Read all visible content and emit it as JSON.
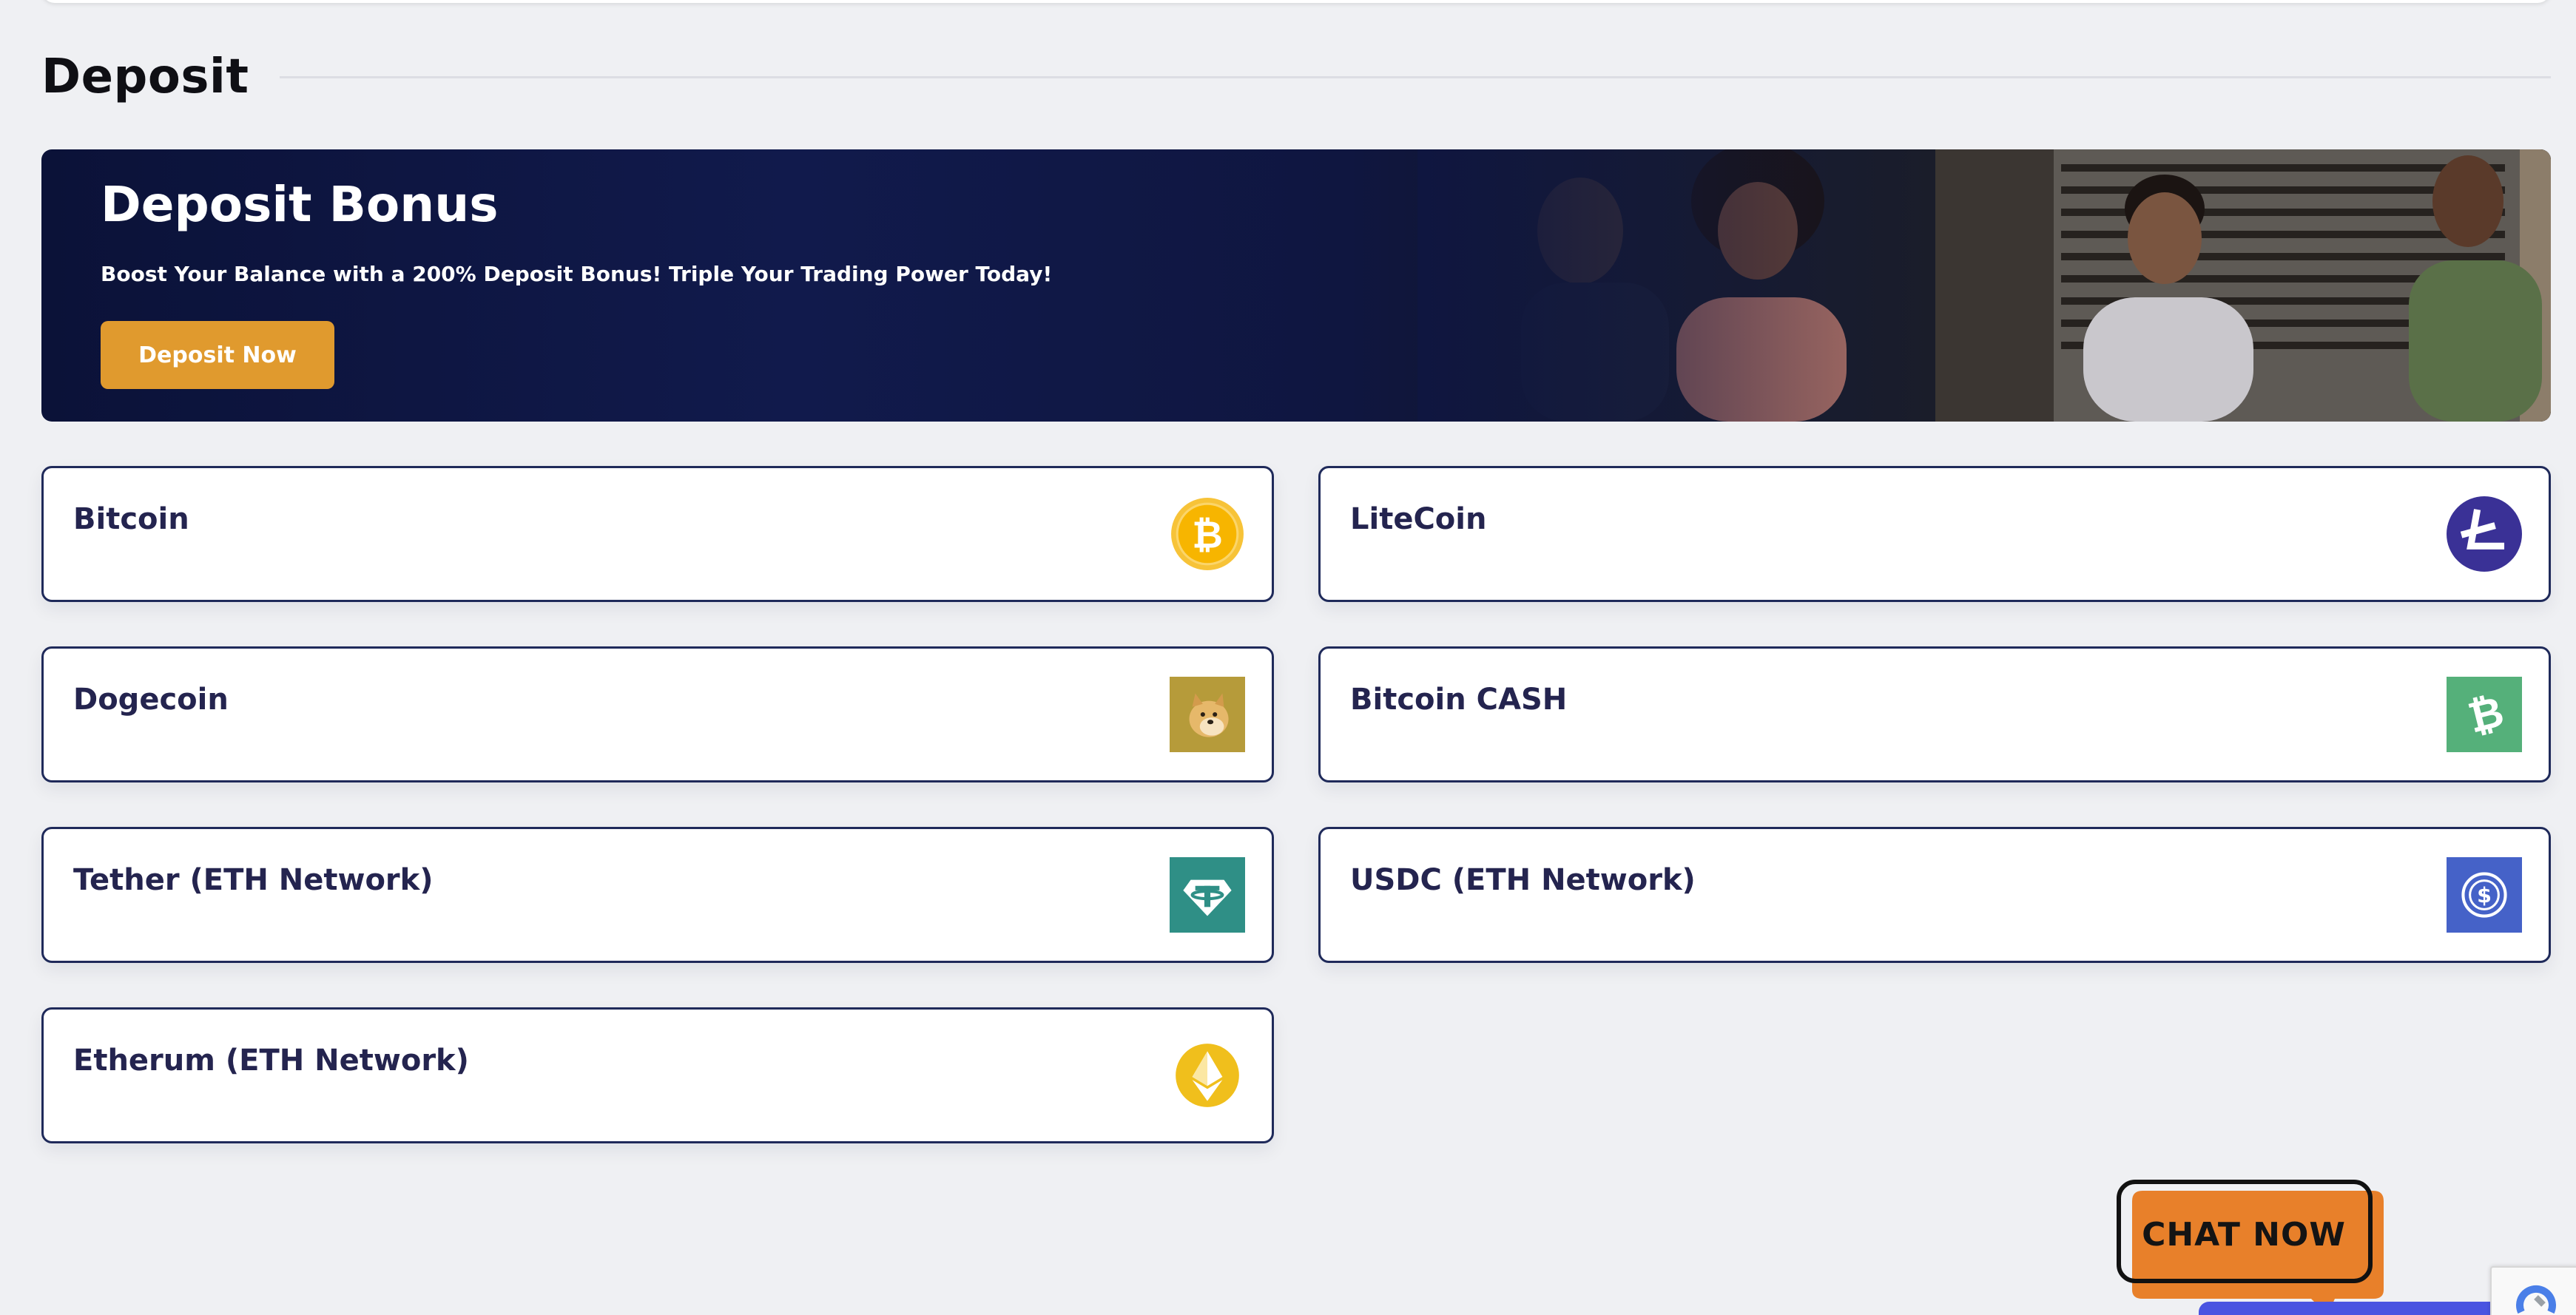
{
  "section": {
    "title": "Deposit"
  },
  "banner": {
    "title": "Deposit Bonus",
    "subtitle": "Boost Your Balance with a 200% Deposit Bonus! Triple Your Trading Power Today!",
    "button_label": "Deposit Now"
  },
  "methods": [
    {
      "label": "Bitcoin",
      "icon": "bitcoin-icon"
    },
    {
      "label": "LiteCoin",
      "icon": "litecoin-icon"
    },
    {
      "label": "Dogecoin",
      "icon": "dogecoin-icon"
    },
    {
      "label": "Bitcoin CASH",
      "icon": "bitcoin-cash-icon"
    },
    {
      "label": "Tether (ETH Network)",
      "icon": "tether-icon"
    },
    {
      "label": "USDC (ETH Network)",
      "icon": "usdc-icon"
    },
    {
      "label": "Etherum (ETH Network)",
      "icon": "ethereum-icon"
    }
  ],
  "chat": {
    "label": "CHAT NOW"
  },
  "colors": {
    "accent": "#e09a2e",
    "navy": "#1f2a5a",
    "banner_bg": "#0f1640",
    "bitcoin": "#f7b500",
    "litecoin": "#3a3196",
    "dogecoin": "#b69b3a",
    "bitcoin_cash": "#55b07a",
    "tether": "#2f8f86",
    "usdc": "#4562c8",
    "ethereum": "#f0bf1c",
    "chat": "#e8802a"
  }
}
